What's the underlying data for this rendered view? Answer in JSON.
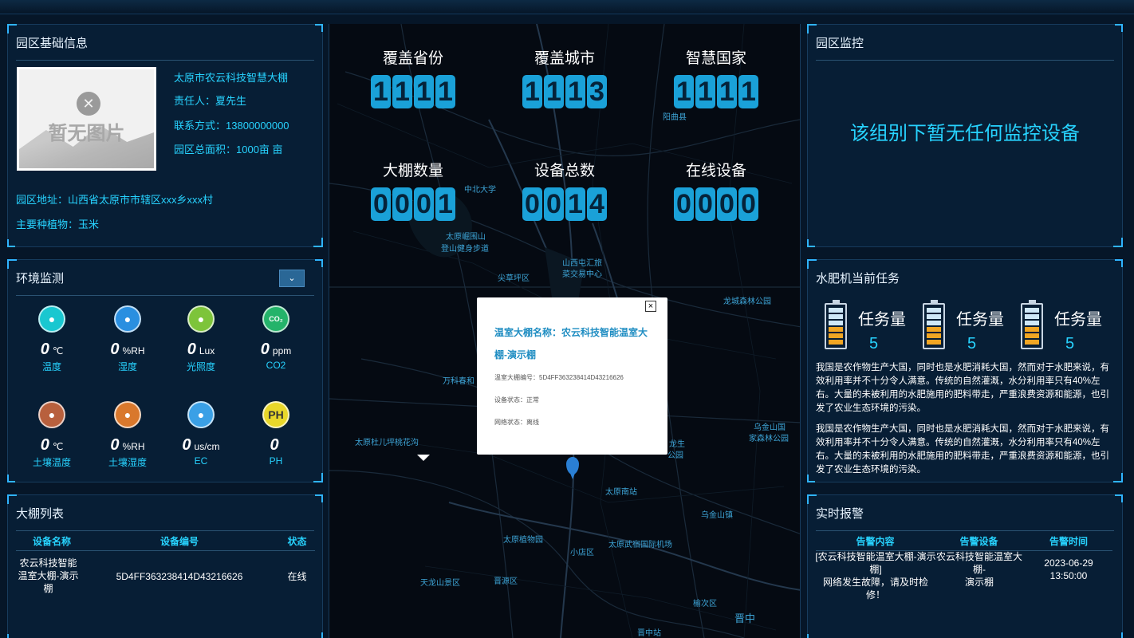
{
  "park_info": {
    "title": "园区基础信息",
    "image_placeholder": "暂无图片",
    "name": "太原市农云科技智慧大棚",
    "manager": "责任人：夏先生",
    "contact": "联系方式：13800000000",
    "area": "园区总面积：1000亩 亩",
    "address": "园区地址：山西省太原市市辖区xxx乡xxx村",
    "crops": "主要种植物：玉米"
  },
  "env": {
    "title": "环境监测",
    "dropdown_icon": "chevron-down",
    "sensors": [
      {
        "icon": "thermometer-icon",
        "value": "0",
        "unit": "℃",
        "label": "温度",
        "color": "#19c7d0"
      },
      {
        "icon": "humidity-icon",
        "value": "0",
        "unit": "%RH",
        "label": "湿度",
        "color": "#2a8fe0"
      },
      {
        "icon": "sun-icon",
        "value": "0",
        "unit": "Lux",
        "label": "光照度",
        "color": "#7dc43a"
      },
      {
        "icon": "co2-icon",
        "value": "0",
        "unit": "ppm",
        "label": "CO2",
        "color": "#24b36a"
      },
      {
        "icon": "soil-thermometer-icon",
        "value": "0",
        "unit": "℃",
        "label": "土壤温度",
        "color": "#b8603d"
      },
      {
        "icon": "soil-humidity-icon",
        "value": "0",
        "unit": "%RH",
        "label": "土壤湿度",
        "color": "#d9782c"
      },
      {
        "icon": "ec-icon",
        "value": "0",
        "unit": "us/cm",
        "label": "EC",
        "color": "#3aa0e6"
      },
      {
        "icon": "ph-icon",
        "value": "0",
        "unit": "",
        "label": "PH",
        "color": "#e8d72a"
      }
    ]
  },
  "greenhouse_list": {
    "title": "大棚列表",
    "headers": [
      "设备名称",
      "设备编号",
      "状态"
    ],
    "rows": [
      {
        "name_lines": [
          "农云科技智能",
          "温室大棚-演示",
          "棚"
        ],
        "id": "5D4FF363238414D43216626",
        "status": "在线"
      }
    ]
  },
  "stats": [
    {
      "title": "覆盖省份",
      "digits": [
        "1",
        "1",
        "1",
        "1"
      ]
    },
    {
      "title": "覆盖城市",
      "digits": [
        "1",
        "1",
        "1",
        "3"
      ]
    },
    {
      "title": "智慧国家",
      "digits": [
        "1",
        "1",
        "1",
        "1"
      ]
    },
    {
      "title": "大棚数量",
      "digits": [
        "0",
        "0",
        "0",
        "1"
      ]
    },
    {
      "title": "设备总数",
      "digits": [
        "0",
        "0",
        "1",
        "4"
      ]
    },
    {
      "title": "在线设备",
      "digits": [
        "0",
        "0",
        "0",
        "0"
      ]
    }
  ],
  "map_labels": [
    "阳曲县",
    "中北大学",
    "太原崛围山",
    "登山健身步道",
    "山西屯汇旅",
    "菜交易中心",
    "尖草坪区",
    "龙城森林公园",
    "万科春和",
    "太原杜儿坪桃花沟",
    "乌金山国",
    "家森林公园",
    "龙生",
    "公园",
    "太原南站",
    "乌金山镇",
    "太原植物园",
    "小店区",
    "太原武宿国际机场",
    "天龙山景区",
    "晋源区",
    "榆次区",
    "晋中",
    "晋中站"
  ],
  "popup": {
    "title": "温室大棚名称：农云科技智能温室大棚-演示棚",
    "line1": "温室大棚编号：5D4FF363238414D43216626",
    "line2": "设备状态：正常",
    "line3": "网络状态：离线",
    "close": "×"
  },
  "monitor": {
    "title": "园区监控",
    "message": "该组别下暂无任何监控设备"
  },
  "fertilizer": {
    "title": "水肥机当前任务",
    "tasks": [
      {
        "label": "任务量",
        "value": "5"
      },
      {
        "label": "任务量",
        "value": "5"
      },
      {
        "label": "任务量",
        "value": "5"
      }
    ],
    "paragraphs": [
      "我国是农作物生产大国，同时也是水肥消耗大国，然而对于水肥来说，有效利用率并不十分令人满意。传统的自然灌溉，水分利用率只有40%左右。大量的未被利用的水肥施用的肥料带走，严重浪费资源和能源，也引发了农业生态环境的污染。",
      "我国是农作物生产大国，同时也是水肥消耗大国，然而对于水肥来说，有效利用率并不十分令人满意。传统的自然灌溉，水分利用率只有40%左右。大量的未被利用的水肥施用的肥料带走，严重浪费资源和能源，也引发了农业生态环境的污染。"
    ]
  },
  "alarm": {
    "title": "实时报警",
    "headers": [
      "告警内容",
      "告警设备",
      "告警时间"
    ],
    "rows": [
      {
        "content_lines": [
          "[农云科技智能温室大棚-演示棚]",
          "网络发生故障，请及时检修！"
        ],
        "device_lines": [
          "农云科技智能温室大棚-",
          "演示棚"
        ],
        "time": "2023-06-29 13:50:00"
      }
    ]
  }
}
